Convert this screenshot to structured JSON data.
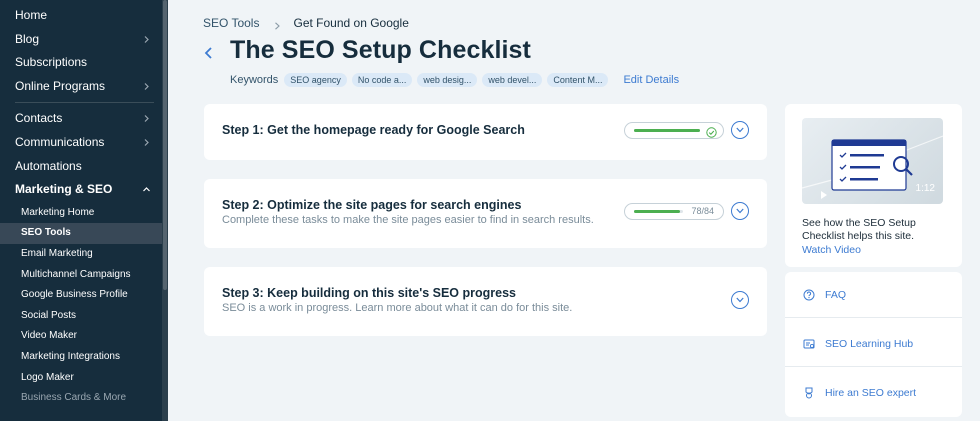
{
  "sidebar": {
    "top_items": [
      {
        "label": "Home",
        "chevron": false
      },
      {
        "label": "Blog",
        "chevron": true
      },
      {
        "label": "Subscriptions",
        "chevron": false
      },
      {
        "label": "Online Programs",
        "chevron": true
      }
    ],
    "mid_items": [
      {
        "label": "Contacts",
        "chevron": true
      },
      {
        "label": "Communications",
        "chevron": true
      },
      {
        "label": "Automations",
        "chevron": false
      },
      {
        "label": "Marketing & SEO",
        "chevron": "up"
      }
    ],
    "sub_items": [
      "Marketing Home",
      "SEO Tools",
      "Email Marketing",
      "Multichannel Campaigns",
      "Google Business Profile",
      "Social Posts",
      "Video Maker",
      "Marketing Integrations",
      "Logo Maker",
      "Business Cards & More"
    ],
    "active_sub": "SEO Tools"
  },
  "breadcrumb": {
    "parent": "SEO Tools",
    "current": "Get Found on Google"
  },
  "page": {
    "title": "The SEO Setup Checklist",
    "keywords_label": "Keywords",
    "keywords": [
      "SEO agency",
      "No code a...",
      "web desig...",
      "web devel...",
      "Content M..."
    ],
    "edit_label": "Edit Details"
  },
  "steps": [
    {
      "title": "Step 1: Get the homepage ready for Google Search",
      "subtitle": "",
      "progress": 1.0,
      "complete": true,
      "count": ""
    },
    {
      "title": "Step 2: Optimize the site pages for search engines",
      "subtitle": "Complete these tasks to make the site pages easier to find in search results.",
      "progress": 0.93,
      "complete": false,
      "count": "78/84"
    },
    {
      "title": "Step 3: Keep building on this site's SEO progress",
      "subtitle": "SEO is a work in progress. Learn more about what it can do for this site.",
      "progress": null,
      "complete": false,
      "count": ""
    }
  ],
  "side": {
    "video_time": "1:12",
    "description": "See how the SEO Setup Checklist helps this site.",
    "watch_label": "Watch Video",
    "links": [
      "FAQ",
      "SEO Learning Hub",
      "Hire an SEO expert"
    ]
  },
  "colors": {
    "sidebar_bg": "#162d3d",
    "accent": "#3d7bd1",
    "progress": "#4caf50"
  }
}
